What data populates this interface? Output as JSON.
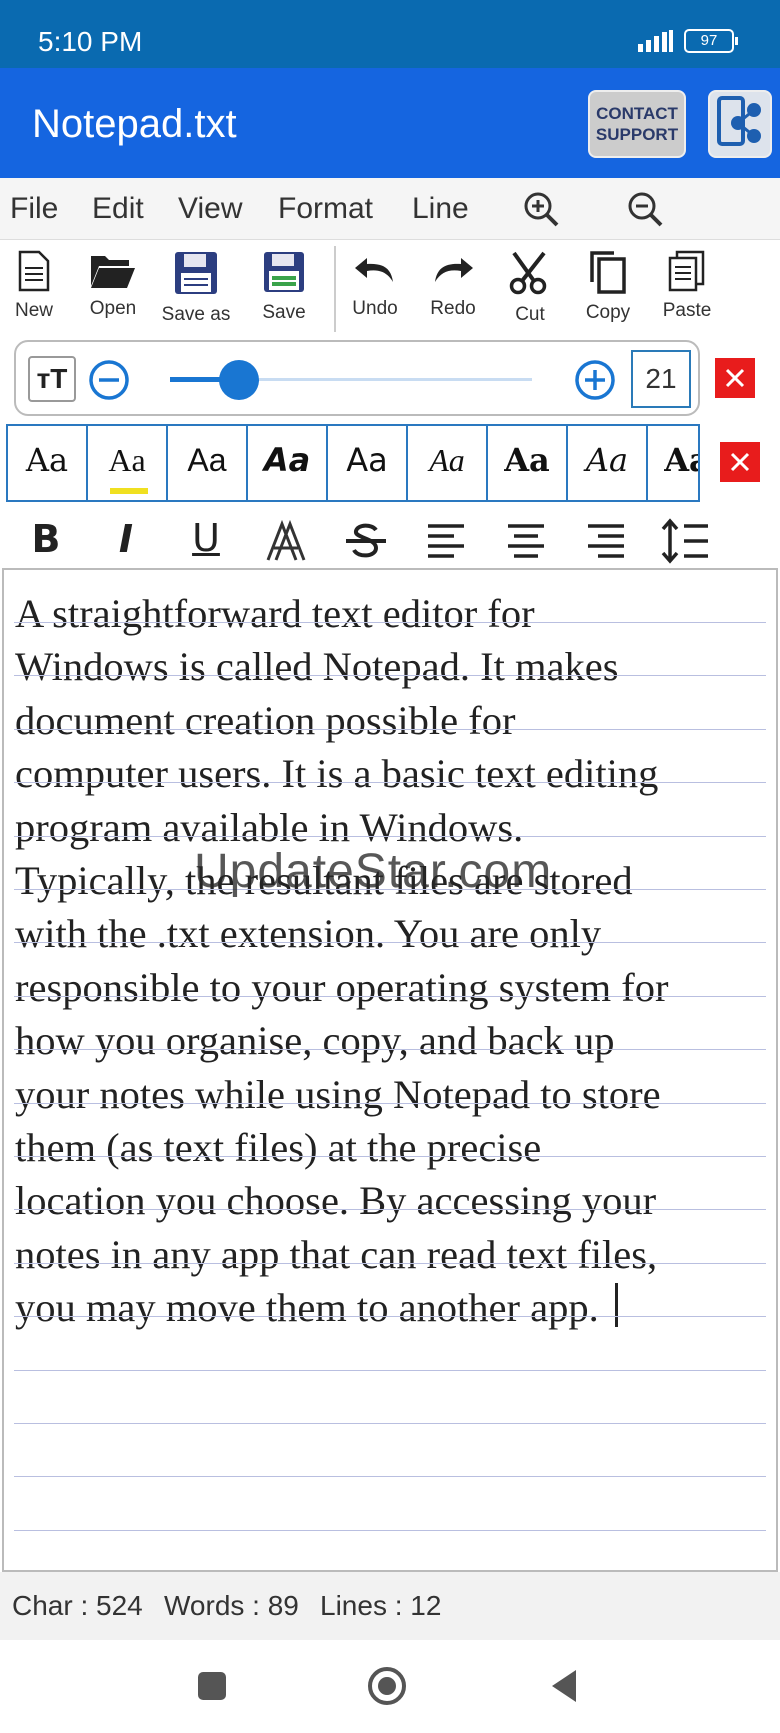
{
  "status_bar": {
    "time": "5:10 PM",
    "battery": "97"
  },
  "app_bar": {
    "title": "Notepad.txt",
    "contact_line1": "CONTACT",
    "contact_line2": "SUPPORT"
  },
  "menu": {
    "file": "File",
    "edit": "Edit",
    "view": "View",
    "format": "Format",
    "line": "Line"
  },
  "toolbar": {
    "new": "New",
    "open": "Open",
    "save_as": "Save as",
    "save": "Save",
    "undo": "Undo",
    "redo": "Redo",
    "cut": "Cut",
    "copy": "Copy",
    "paste": "Paste"
  },
  "font_size": {
    "value": "21",
    "level": 0.19
  },
  "font_samples": [
    "Aa",
    "Aa",
    "Aa",
    "Aa",
    "Aa",
    "Aa",
    "Aa",
    "Aa",
    "Aa"
  ],
  "selected_font_index": 1,
  "format": {
    "bold": "B",
    "italic": "I",
    "underline": "U"
  },
  "editor": {
    "text": "A straightforward text editor for\nWindows is called Notepad. It makes\ndocument creation possible for\ncomputer users. It is a basic text editing\nprogram available in Windows.\nTypically, the resultant files are stored\nwith the .txt extension. You are only\nresponsible to your operating system for\nhow you organise, copy, and back up\nyour notes while using Notepad to store\nthem (as text files) at the precise\nlocation you choose. By accessing your\nnotes in any app that can read text files,\nyou may move them to another app. "
  },
  "watermark": "UpdateStar.com",
  "stats": {
    "chars": "Char : 524",
    "words": "Words : 89",
    "lines": "Lines : 12"
  },
  "colors": {
    "status_bar": "#0a6ab0",
    "app_bar": "#1565e0",
    "accent": "#1976d2",
    "close_red": "#e81c1c",
    "highlight": "#f0e020"
  }
}
